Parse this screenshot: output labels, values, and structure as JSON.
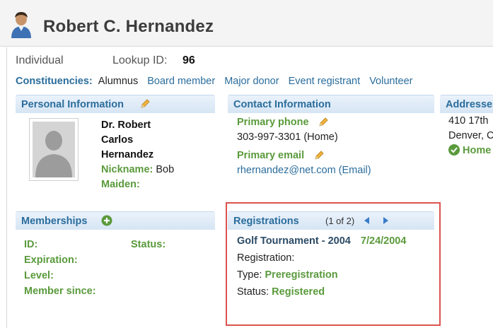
{
  "header": {
    "title": "Robert C. Hernandez",
    "icon": "person-icon"
  },
  "summary": {
    "type": "Individual",
    "lookup_label": "Lookup ID:",
    "lookup_value": "96"
  },
  "constituencies": {
    "label": "Constituencies:",
    "items": [
      "Alumnus",
      "Board member",
      "Major donor",
      "Event registrant",
      "Volunteer"
    ]
  },
  "personal": {
    "title": "Personal Information",
    "name_lines": [
      "Dr. Robert",
      "Carlos",
      "Hernandez"
    ],
    "nickname_label": "Nickname:",
    "nickname_value": "Bob",
    "maiden_label": "Maiden:",
    "maiden_value": ""
  },
  "contact": {
    "title": "Contact Information",
    "phone_label": "Primary phone",
    "phone_value": "303-997-3301 (Home)",
    "email_label": "Primary email",
    "email_value": "rhernandez@net.com (Email)"
  },
  "addresses": {
    "title": "Addresses",
    "line1": "410 17th",
    "line2": "Denver, C",
    "type": "Home"
  },
  "memberships": {
    "title": "Memberships",
    "id_label": "ID:",
    "status_label": "Status:",
    "expiration_label": "Expiration:",
    "level_label": "Level:",
    "member_since_label": "Member since:"
  },
  "registrations": {
    "title": "Registrations",
    "pager": "(1 of 2)",
    "event_name": "Golf Tournament - 2004",
    "event_date": "7/24/2004",
    "registration_label": "Registration:",
    "type_label": "Type:",
    "type_value": "Preregistration",
    "status_label": "Status:",
    "status_value": "Registered"
  },
  "colors": {
    "accent": "#2b6d9c",
    "label_green": "#5a9a3c",
    "highlight": "#d9534f",
    "header_bg": "#d6e5f4"
  }
}
